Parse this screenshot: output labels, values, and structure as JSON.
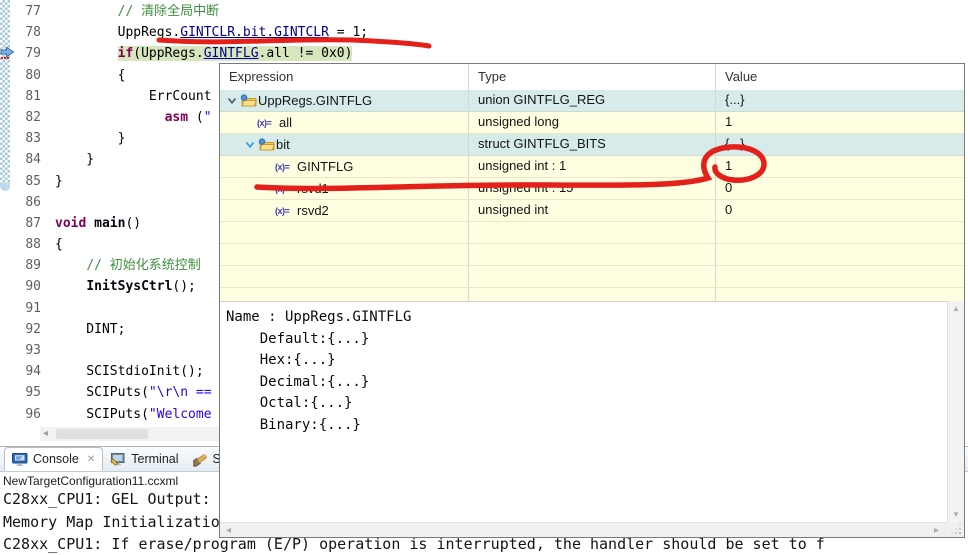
{
  "colors": {
    "annotation_red": "#e3211a",
    "debug_line_green": "#d7e6bd",
    "row_teal": "#d7ebeb",
    "row_yellow": "#fffee1",
    "keyword": "#7f0055",
    "comment": "#3f8f3f",
    "string": "#2a00ff",
    "hyperlink": "#000090"
  },
  "code": {
    "lines": [
      {
        "num": "77",
        "segs": [
          {
            "c": "",
            "t": "        "
          },
          {
            "c": "com",
            "t": "// 清除全局中断"
          }
        ]
      },
      {
        "num": "78",
        "segs": [
          {
            "c": "",
            "t": "        "
          },
          {
            "c": "",
            "t": "UppRegs."
          },
          {
            "c": "link",
            "t": "GINTCLR.bit.GINTCLR"
          },
          {
            "c": "",
            "t": " = 1;"
          }
        ]
      },
      {
        "num": "79",
        "hl": true,
        "segs": [
          {
            "c": "",
            "t": "        "
          },
          {
            "c": "kw",
            "t": "if"
          },
          {
            "c": "",
            "t": "(UppRegs."
          },
          {
            "c": "link",
            "t": "GINTFLG"
          },
          {
            "c": "",
            "t": ".all != 0x0)"
          }
        ]
      },
      {
        "num": "80",
        "segs": [
          {
            "c": "",
            "t": "        {"
          }
        ]
      },
      {
        "num": "81",
        "segs": [
          {
            "c": "",
            "t": "            "
          },
          {
            "c": "",
            "t": "ErrCount"
          }
        ]
      },
      {
        "num": "82",
        "segs": [
          {
            "c": "",
            "t": "              "
          },
          {
            "c": "kw",
            "t": "asm"
          },
          {
            "c": "",
            "t": " ("
          },
          {
            "c": "str",
            "t": "\""
          }
        ]
      },
      {
        "num": "83",
        "segs": [
          {
            "c": "",
            "t": "        }"
          }
        ]
      },
      {
        "num": "84",
        "segs": [
          {
            "c": "",
            "t": "    }"
          }
        ]
      },
      {
        "num": "85",
        "segs": [
          {
            "c": "",
            "t": "}"
          }
        ]
      },
      {
        "num": "86",
        "segs": []
      },
      {
        "num": "87",
        "segs": [
          {
            "c": "kw",
            "t": "void"
          },
          {
            "c": "",
            "t": " "
          },
          {
            "c": "fn",
            "t": "main"
          },
          {
            "c": "",
            "t": "()"
          }
        ]
      },
      {
        "num": "88",
        "segs": [
          {
            "c": "",
            "t": "{"
          }
        ]
      },
      {
        "num": "89",
        "segs": [
          {
            "c": "",
            "t": "    "
          },
          {
            "c": "com",
            "t": "// 初始化系统控制"
          }
        ]
      },
      {
        "num": "90",
        "segs": [
          {
            "c": "",
            "t": "    "
          },
          {
            "c": "fn",
            "t": "InitSysCtrl"
          },
          {
            "c": "",
            "t": "();"
          }
        ]
      },
      {
        "num": "91",
        "segs": []
      },
      {
        "num": "92",
        "segs": [
          {
            "c": "",
            "t": "    DINT;"
          }
        ]
      },
      {
        "num": "93",
        "segs": []
      },
      {
        "num": "94",
        "segs": [
          {
            "c": "",
            "t": "    SCIStdioInit();"
          }
        ]
      },
      {
        "num": "95",
        "segs": [
          {
            "c": "",
            "t": "    SCIPuts("
          },
          {
            "c": "str",
            "t": "\"\\r\\n =="
          }
        ]
      },
      {
        "num": "96",
        "segs": [
          {
            "c": "",
            "t": "    SCIPuts("
          },
          {
            "c": "str",
            "t": "\"Welcome"
          }
        ]
      }
    ]
  },
  "popup": {
    "columns": [
      "Expression",
      "Type",
      "Value"
    ],
    "rows": [
      {
        "level": 0,
        "chev": "dark",
        "icon": "struct",
        "label": "UppRegs.GINTFLG",
        "type": "union GINTFLG_REG",
        "value": "{...}",
        "bg": "teal"
      },
      {
        "level": 1,
        "chev": "none",
        "icon": "var",
        "label": "all",
        "type": "unsigned long",
        "value": "1",
        "bg": "yellow"
      },
      {
        "level": 1,
        "chev": "blue",
        "icon": "struct",
        "label": "bit",
        "type": "struct GINTFLG_BITS",
        "value": "{...}",
        "bg": "teal"
      },
      {
        "level": 2,
        "chev": "none",
        "icon": "var",
        "label": "GINTFLG",
        "type": "unsigned int : 1",
        "value": "1",
        "bg": "yellow"
      },
      {
        "level": 2,
        "chev": "none",
        "icon": "var",
        "label": "rsvd1",
        "type": "unsigned int : 15",
        "value": "0",
        "bg": "yellow"
      },
      {
        "level": 2,
        "chev": "none",
        "icon": "var",
        "label": "rsvd2",
        "type": "unsigned int",
        "value": "0",
        "bg": "yellow"
      }
    ],
    "empty_row_count": 4,
    "details": [
      "Name : UppRegs.GINTFLG",
      "    Default:{...}",
      "    Hex:{...}",
      "    Decimal:{...}",
      "    Octal:{...}",
      "    Binary:{...}"
    ]
  },
  "console": {
    "tabs": [
      {
        "label": "Console",
        "active": true,
        "close": "✕",
        "icon": "console-icon"
      },
      {
        "label": "Terminal",
        "active": false,
        "icon": "terminal-icon"
      },
      {
        "label": "Search",
        "active": false,
        "icon": "search-icon"
      }
    ],
    "title": "NewTargetConfiguration11.ccxml",
    "output": [
      "C28xx_CPU1: GEL Output:",
      "Memory Map Initializatio"
    ],
    "output_partial": "C28xx_CPU1: If erase/program (E/P) operation is interrupted, the handler should be set to f"
  },
  "scroll": {
    "left": "◂",
    "right": "▸",
    "up": "▴",
    "down": "▾"
  }
}
